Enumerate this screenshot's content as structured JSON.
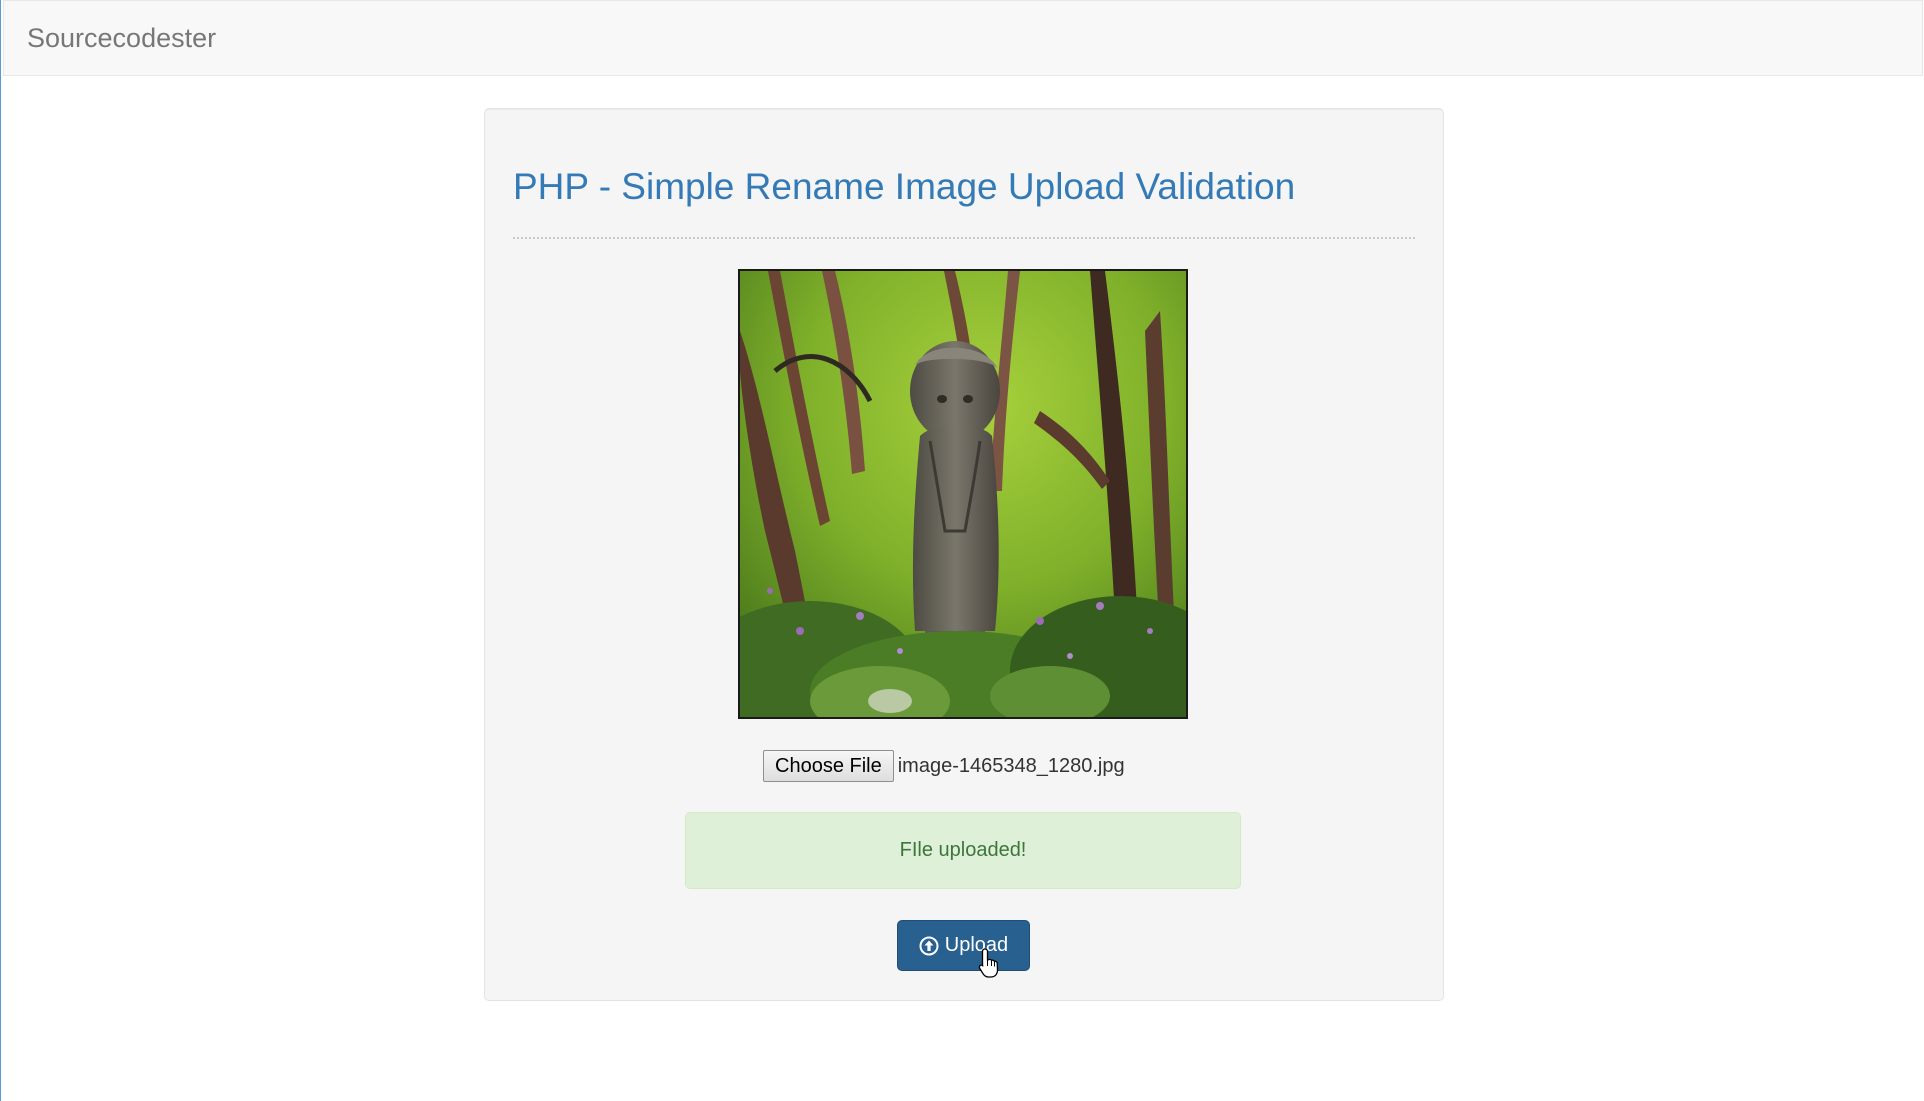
{
  "navbar": {
    "brand": "Sourcecodester"
  },
  "main": {
    "title": "PHP - Simple Rename Image Upload Validation",
    "preview_image": {
      "icon": "uploaded-photo-garden-statue"
    },
    "file_input": {
      "button_label": "Choose File",
      "file_name": "image-1465348_1280.jpg"
    },
    "alert": {
      "message": "FIle uploaded!",
      "type": "success"
    },
    "upload_button": {
      "label": "Upload",
      "icon": "circle-arrow-up-icon"
    }
  },
  "colors": {
    "title": "#337ab7",
    "button_primary": "#286090",
    "alert_bg": "#dff0d8",
    "alert_text": "#3c763d"
  }
}
